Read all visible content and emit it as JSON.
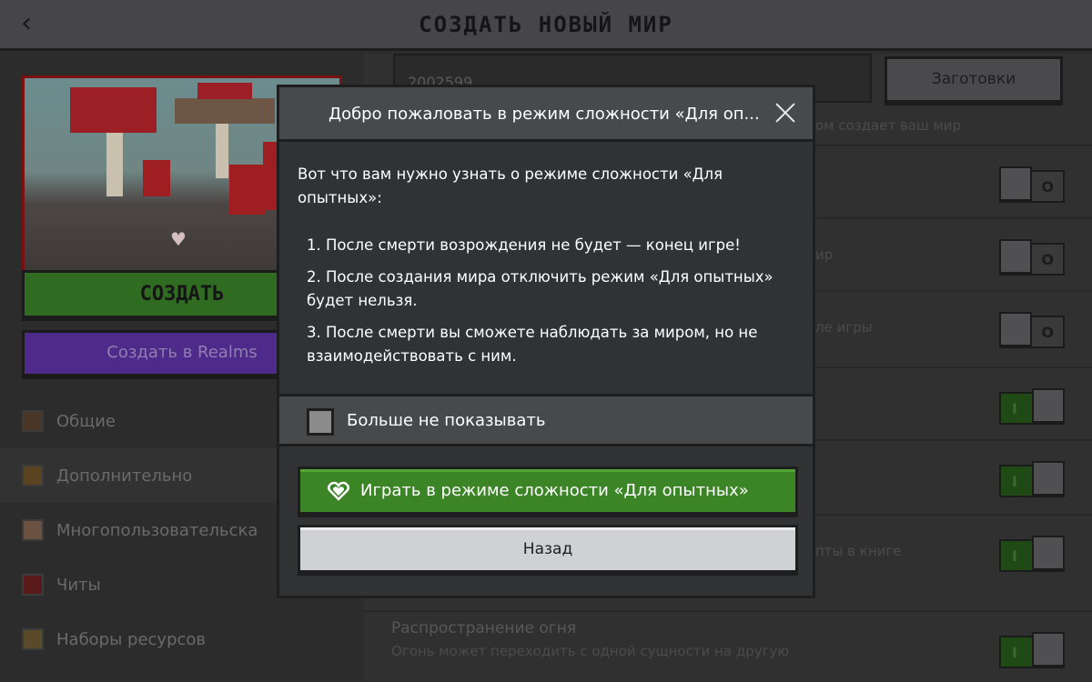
{
  "header": {
    "title": "СОЗДАТЬ НОВЫЙ МИР",
    "back_icon": "chevron-left-icon"
  },
  "left_panel": {
    "create_label": "СОЗДАТЬ",
    "create_realms_label": "Создать в Realms",
    "nav": [
      {
        "label": "Общие",
        "icon": "gear-icon"
      },
      {
        "label": "Дополнительно",
        "icon": "chest-icon"
      },
      {
        "label": "Многопользовательска",
        "icon": "player-face-icon"
      },
      {
        "label": "Читы",
        "icon": "cheats-icon"
      },
      {
        "label": "Наборы ресурсов",
        "icon": "resource-pack-icon"
      }
    ]
  },
  "right_panel": {
    "seed_value": "2002599",
    "presets_label": "Заготовки",
    "seed_caption": "ом создает ваш мир",
    "settings": [
      {
        "label": "",
        "sub": "",
        "state": "off"
      },
      {
        "label": "",
        "sub": "ир",
        "state": "off"
      },
      {
        "label": "",
        "sub": "ле игры",
        "state": "off"
      },
      {
        "label": "",
        "sub": "",
        "state": "on"
      },
      {
        "label": "",
        "sub": "",
        "state": "on"
      },
      {
        "label": "",
        "sub": "пты в книге",
        "state": "on"
      },
      {
        "label": "Распространение огня",
        "sub": "Огонь может переходить с одной сущности на другую",
        "state": "on"
      }
    ],
    "toggle_on_mark": "I",
    "toggle_off_mark": "O"
  },
  "modal": {
    "title": "Добро пожаловать в режим сложности «Для опытных»",
    "intro": "Вот что вам нужно узнать о режиме сложности «Для опытных»:",
    "points": [
      "1. После смерти возрождения не будет — конец игре!",
      "2. После создания мира отключить режим «Для опытных» будет нельзя.",
      "3. После смерти вы сможете наблюдать за миром, но не взаимодействовать с ним."
    ],
    "dont_show_label": "Больше не показывать",
    "dont_show_checked": false,
    "play_label": "Играть в режиме сложности «Для опытных»",
    "back_label": "Назад",
    "colors": {
      "play_green": "#3c8527",
      "header": "#48494a",
      "body": "#313233"
    }
  }
}
